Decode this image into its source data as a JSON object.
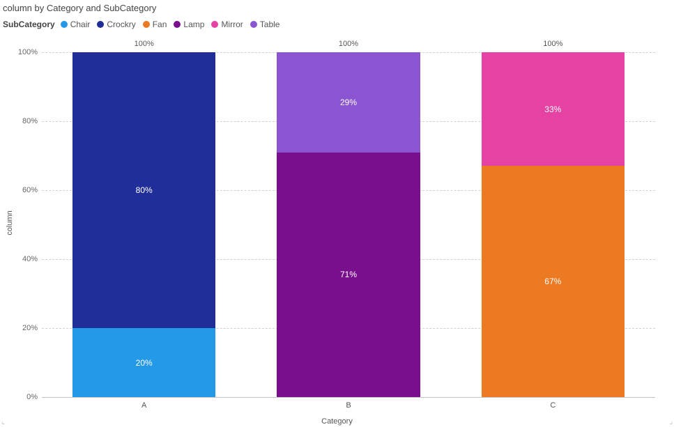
{
  "title": "column by Category and SubCategory",
  "legend_title": "SubCategory",
  "legend_items": [
    {
      "name": "Chair",
      "color": "#2399e8"
    },
    {
      "name": "Crockry",
      "color": "#1f2e99"
    },
    {
      "name": "Fan",
      "color": "#ec7a23"
    },
    {
      "name": "Lamp",
      "color": "#7a0f8e"
    },
    {
      "name": "Mirror",
      "color": "#e542a4"
    },
    {
      "name": "Table",
      "color": "#8b55d1"
    }
  ],
  "y_ticks": [
    "0%",
    "20%",
    "40%",
    "60%",
    "80%",
    "100%"
  ],
  "y_axis_label": "column",
  "x_axis_label": "Category",
  "bar_total_label": "100%",
  "chart_data": {
    "type": "bar",
    "stacked": true,
    "percent": true,
    "title": "column by Category and SubCategory",
    "xlabel": "Category",
    "ylabel": "column",
    "ylim": [
      0,
      100
    ],
    "categories": [
      "A",
      "B",
      "C"
    ],
    "series": [
      {
        "name": "Chair",
        "color": "#2399e8",
        "values": [
          20,
          null,
          null
        ]
      },
      {
        "name": "Crockry",
        "color": "#1f2e99",
        "values": [
          80,
          null,
          null
        ]
      },
      {
        "name": "Fan",
        "color": "#ec7a23",
        "values": [
          null,
          null,
          67
        ]
      },
      {
        "name": "Lamp",
        "color": "#7a0f8e",
        "values": [
          null,
          71,
          null
        ]
      },
      {
        "name": "Mirror",
        "color": "#e542a4",
        "values": [
          null,
          null,
          33
        ]
      },
      {
        "name": "Table",
        "color": "#8b55d1",
        "values": [
          null,
          29,
          null
        ]
      }
    ]
  }
}
